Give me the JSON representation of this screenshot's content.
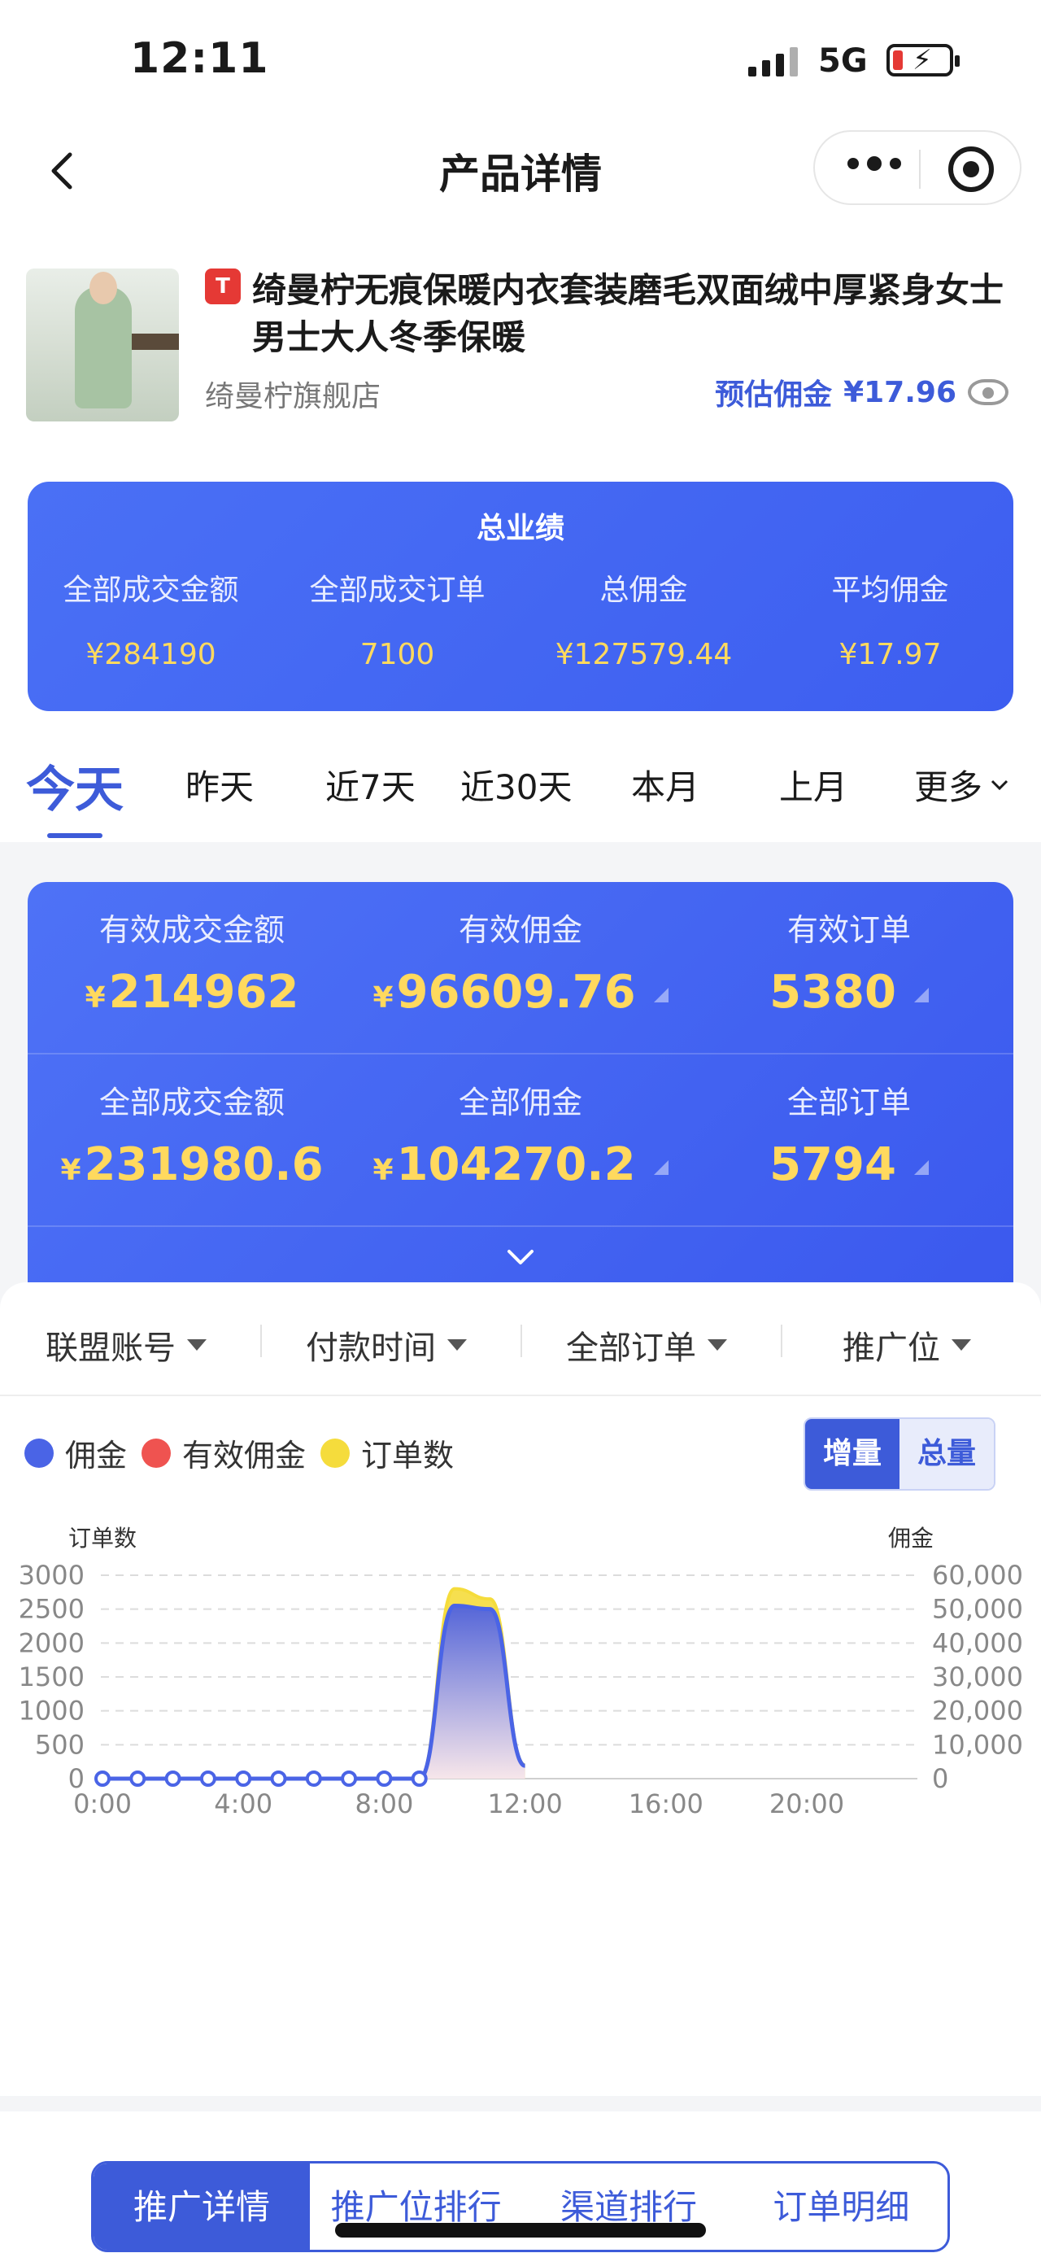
{
  "status_bar": {
    "time": "12:11",
    "network": "5G"
  },
  "nav": {
    "title": "产品详情"
  },
  "product": {
    "badge": "T",
    "title": "绮曼柠无痕保暖内衣套装磨毛双面绒中厚紧身女士男士大人冬季保暖",
    "shop": "绮曼柠旗舰店",
    "commission_label": "预估佣金",
    "commission_value": "¥17.96"
  },
  "total": {
    "title": "总业绩",
    "items": [
      {
        "label": "全部成交金额",
        "value": "¥284190"
      },
      {
        "label": "全部成交订单",
        "value": "7100"
      },
      {
        "label": "总佣金",
        "value": "¥127579.44"
      },
      {
        "label": "平均佣金",
        "value": "¥17.97"
      }
    ]
  },
  "tabs": [
    "今天",
    "昨天",
    "近7天",
    "近30天",
    "本月",
    "上月",
    "更多"
  ],
  "active_tab": "今天",
  "metrics": {
    "row1": [
      {
        "label": "有效成交金额",
        "currency": "¥",
        "value": "214962"
      },
      {
        "label": "有效佣金",
        "currency": "¥",
        "value": "96609.76"
      },
      {
        "label": "有效订单",
        "currency": "",
        "value": "5380"
      }
    ],
    "row2": [
      {
        "label": "全部成交金额",
        "currency": "¥",
        "value": "231980.6"
      },
      {
        "label": "全部佣金",
        "currency": "¥",
        "value": "104270.2"
      },
      {
        "label": "全部订单",
        "currency": "",
        "value": "5794"
      }
    ]
  },
  "filters": [
    "联盟账号",
    "付款时间",
    "全部订单",
    "推广位"
  ],
  "legend": [
    {
      "name": "佣金",
      "color": "#4a64e6"
    },
    {
      "name": "有效佣金",
      "color": "#ef5350"
    },
    {
      "name": "订单数",
      "color": "#f5dc3c"
    }
  ],
  "segment": {
    "options": [
      "增量",
      "总量"
    ],
    "selected": "增量"
  },
  "chart_data": {
    "type": "area",
    "left_axis_label": "订单数",
    "right_axis_label": "佣金",
    "left_ticks": [
      "3000",
      "2500",
      "2000",
      "1500",
      "1000",
      "500",
      "0"
    ],
    "right_ticks": [
      "60,000",
      "50,000",
      "40,000",
      "30,000",
      "20,000",
      "10,000",
      "0"
    ],
    "x_ticks": [
      "0:00",
      "4:00",
      "8:00",
      "12:00",
      "16:00",
      "20:00"
    ],
    "ylim_left": [
      0,
      3000
    ],
    "ylim_right": [
      0,
      60000
    ],
    "x_hours": [
      0,
      1,
      2,
      3,
      4,
      5,
      6,
      7,
      8,
      9,
      10,
      11,
      12
    ],
    "series": [
      {
        "name": "订单数",
        "axis": "left",
        "color": "#f5dc3c",
        "values": [
          0,
          0,
          0,
          0,
          0,
          0,
          0,
          0,
          0,
          0,
          2800,
          2650,
          200
        ]
      },
      {
        "name": "佣金",
        "axis": "right",
        "color": "#4a64e6",
        "values": [
          0,
          0,
          0,
          0,
          0,
          0,
          0,
          0,
          0,
          0,
          51000,
          50000,
          3800
        ]
      }
    ],
    "grid": true
  },
  "bottom_tabs": [
    "推广详情",
    "推广位排行",
    "渠道排行",
    "订单明细"
  ],
  "active_bottom_tab": "推广详情"
}
